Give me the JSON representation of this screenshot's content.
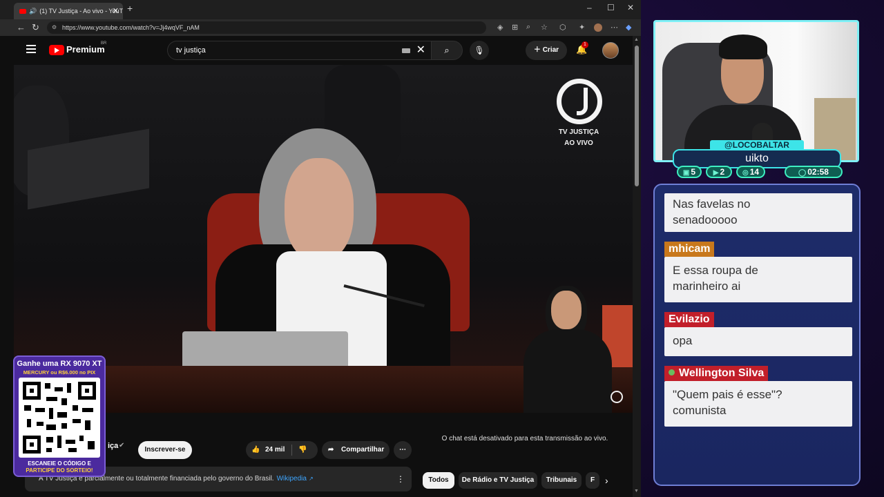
{
  "browser": {
    "tab_title": "(1) TV Justiça - Ao vivo - YouTube",
    "url": "https://www.youtube.com/watch?v=Jj4wqVF_nAM"
  },
  "youtube": {
    "brand": "Premium",
    "region": "BR",
    "search_value": "tv justiça",
    "create_label": "Criar",
    "notif_count": "1",
    "video_overlay": {
      "line1": "TV JUSTIÇA",
      "line2": "AO VIVO"
    },
    "video_title": "vo",
    "channel_name": "iça",
    "subscribe_label": "Inscrever-se",
    "likes": "24 mil",
    "share_label": "Compartilhar",
    "info_text": "A TV Justiça é parcialmente ou totalmente financiada pelo governo do Brasil.",
    "info_link": "Wikipedia",
    "chat_disabled": "O chat está desativado para esta transmissão ao vivo.",
    "chips": [
      "Todos",
      "De Rádio e TV Justiça",
      "Tribunais",
      "F"
    ]
  },
  "promo": {
    "line1": "Ganhe uma RX 9070 XT",
    "line2": "MERCURY ou R$6.000 no PIX",
    "line3": "ESCANEIE O CÓDIGO E",
    "line4": "PARTICIPE DO SORTEIO!"
  },
  "stream": {
    "handle": "@LOCOBALTAR",
    "caption": "uikto",
    "stats": {
      "chat": "5",
      "youtube": "2",
      "tips": "14",
      "time": "02:58"
    }
  },
  "chat": [
    {
      "author": "",
      "text_lines": [
        "Nas favelas no",
        "senadooooo"
      ],
      "author_color": ""
    },
    {
      "author": "mhicam",
      "text_lines": [
        "E essa roupa de",
        "marinheiro ai"
      ],
      "author_color": "#c8781c"
    },
    {
      "author": "Evilazio",
      "text_lines": [
        "opa"
      ],
      "author_color": "#c21f2a"
    },
    {
      "author": "Wellington Silva",
      "text_lines": [
        "\"Quem pais é esse\"?",
        "comunista"
      ],
      "author_color": "#c21f2a"
    }
  ],
  "colors": {
    "accent_cyan": "#3de4e8",
    "yt_red": "#ff0000",
    "panel_blue": "#1e2c6a"
  }
}
